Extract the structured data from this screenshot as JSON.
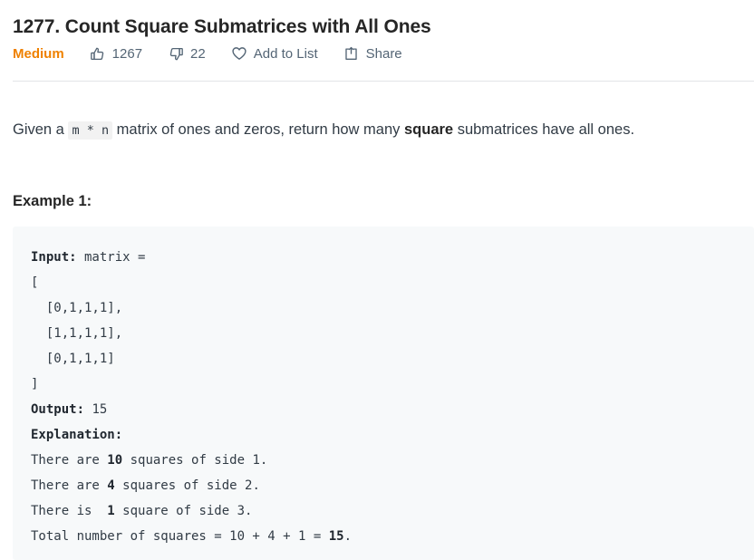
{
  "problem": {
    "title": "1277. Count Square Submatrices with All Ones",
    "difficulty": "Medium",
    "difficulty_color": "#ef8100"
  },
  "actions": {
    "likes": {
      "icon": "thumbs-up-icon",
      "count": "1267"
    },
    "dislikes": {
      "icon": "thumbs-down-icon",
      "count": "22"
    },
    "add_to_list": {
      "icon": "heart-icon",
      "label": "Add to List"
    },
    "share": {
      "icon": "share-icon",
      "label": "Share"
    }
  },
  "description": {
    "lead": "Given a ",
    "inline_code": "m * n",
    "mid": " matrix of ones and zeros, return how many ",
    "bold": "square",
    "tail": " submatrices have all ones."
  },
  "example": {
    "heading": "Example 1:",
    "input_label": "Input:",
    "input_value": " matrix =",
    "matrix_open": "[",
    "matrix_rows": [
      "  [0,1,1,1],",
      "  [1,1,1,1],",
      "  [0,1,1,1]"
    ],
    "matrix_close": "]",
    "output_label": "Output:",
    "output_value": " 15",
    "explanation_label": "Explanation:",
    "explanation_lines": [
      {
        "pre": "There are ",
        "strong": "10",
        "post": " squares of side 1."
      },
      {
        "pre": "There are ",
        "strong": "4",
        "post": " squares of side 2."
      },
      {
        "pre": "There is  ",
        "strong": "1",
        "post": " square of side 3."
      },
      {
        "pre": "Total number of squares = 10 + 4 + 1 = ",
        "strong": "15",
        "post": "."
      }
    ]
  },
  "theme": {
    "code_bg": "#f7f9fa",
    "inline_code_bg": "#f2f2f2",
    "text": "#313b45",
    "muted": "#546575",
    "divider": "#e3e4e8"
  }
}
